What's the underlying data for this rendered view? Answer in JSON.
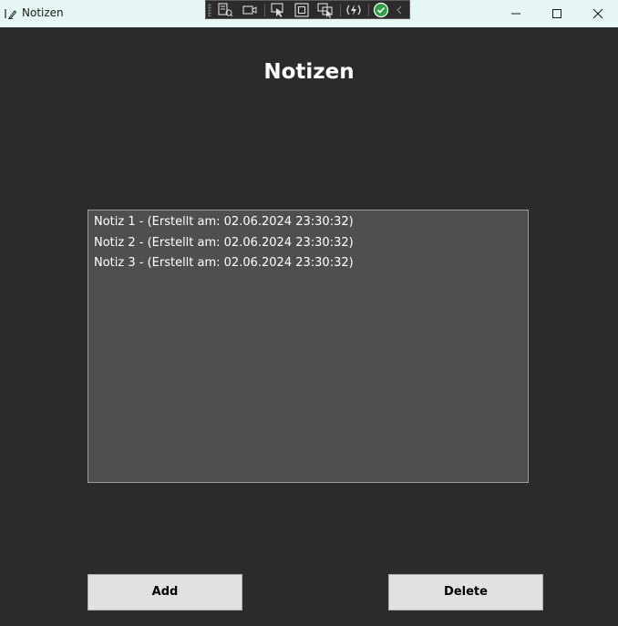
{
  "window": {
    "title": "Notizen",
    "controls": [
      "minimize-icon",
      "maximize-icon",
      "close-icon"
    ]
  },
  "debug_toolbar": {
    "icons": [
      "live-visual-tree-icon",
      "record-icon",
      "select-element-icon",
      "display-layout-adorners-icon",
      "track-focus-icon",
      "hot-reload-icon",
      "accessibility-check-icon",
      "collapse-chevron-icon"
    ]
  },
  "main": {
    "heading": "Notizen",
    "notes": [
      "Notiz 1 - (Erstellt am: 02.06.2024 23:30:32)",
      "Notiz 2 - (Erstellt am: 02.06.2024 23:30:32)",
      "Notiz 3 - (Erstellt am: 02.06.2024 23:30:32)"
    ]
  },
  "buttons": {
    "add_label": "Add",
    "delete_label": "Delete"
  },
  "colors": {
    "background": "#2b2b2b",
    "listbox": "#4f4f4f",
    "titlebar": "#e6f6f4",
    "button": "#e1e1e1",
    "check_accent": "#2e9e44"
  }
}
